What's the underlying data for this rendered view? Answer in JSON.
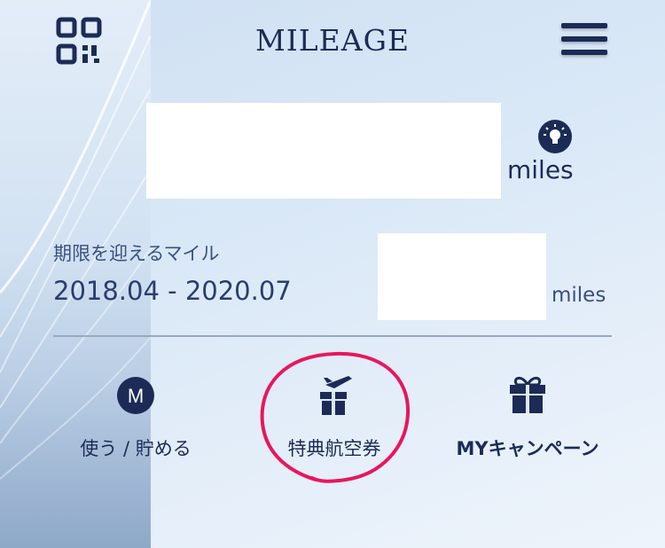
{
  "header": {
    "title": "MILEAGE",
    "qr_icon": "qr-code-icon",
    "menu_icon": "hamburger-menu-icon"
  },
  "balance": {
    "unit": "miles",
    "tip_icon": "lightbulb-icon"
  },
  "expiring": {
    "label": "期限を迎えるマイル",
    "range": "2018.04 - 2020.07",
    "unit": "miles"
  },
  "actions": [
    {
      "label": "使う / 貯める",
      "icon": "m-circle-icon",
      "glyph": "M"
    },
    {
      "label": "特典航空券",
      "icon": "plane-gift-icon"
    },
    {
      "label": "MYキャンペーン",
      "icon": "gift-icon"
    }
  ],
  "colors": {
    "primary": "#1c2b56",
    "annotation": "#e8175d"
  }
}
